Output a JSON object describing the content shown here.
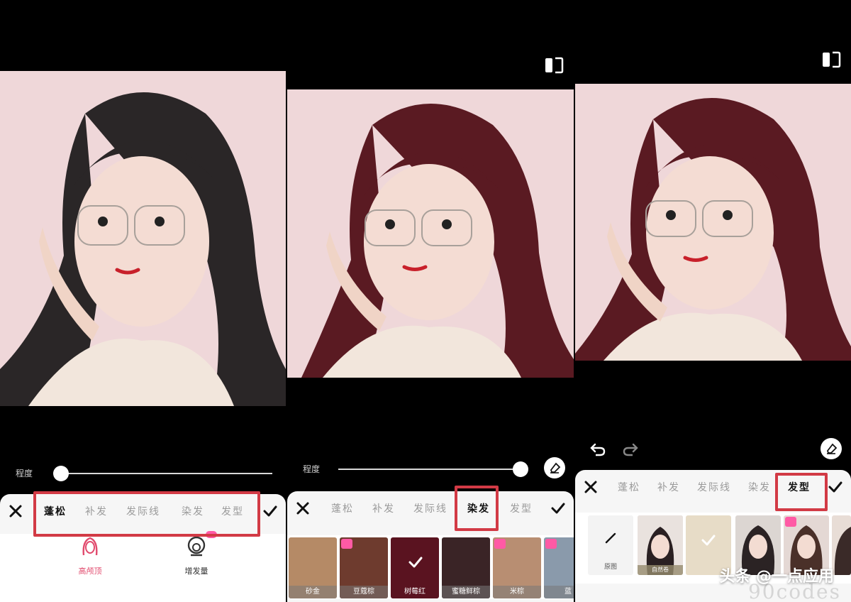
{
  "intensity_label": "程度",
  "tabs": [
    "蓬松",
    "补发",
    "发际线",
    "染发",
    "发型"
  ],
  "panel1": {
    "active_tab": "蓬松",
    "tools": [
      {
        "label": "高颅顶",
        "icon": "head-outline-icon",
        "color": "#e14a6d"
      },
      {
        "label": "增发量",
        "icon": "hair-volume-icon",
        "color": "#333333",
        "vip": true
      }
    ],
    "slider_value": 0.0
  },
  "panel2": {
    "active_tab": "染发",
    "slider_value": 1.0,
    "swatches": [
      {
        "label": "砂金",
        "color": "#b58a66",
        "vip": false
      },
      {
        "label": "豆蔻棕",
        "color": "#6e3b2e",
        "vip": true
      },
      {
        "label": "树莓红",
        "color": "#5a1320",
        "selected": true,
        "vip": false
      },
      {
        "label": "蜜糖鲜棕",
        "color": "#3a2426",
        "vip": false
      },
      {
        "label": "米棕",
        "color": "#b88e72",
        "vip": true
      },
      {
        "label": "蓝",
        "color": "#8a9aab",
        "vip": true
      }
    ]
  },
  "panel3": {
    "active_tab": "发型",
    "styles": [
      {
        "label": "原图",
        "type": "original"
      },
      {
        "label": "自然卷",
        "type": "photo"
      },
      {
        "label": "",
        "type": "selected"
      },
      {
        "label": "",
        "type": "photo"
      },
      {
        "label": "",
        "type": "photo",
        "vip": true
      },
      {
        "label": "",
        "type": "photo"
      }
    ]
  },
  "watermark": "头条 @一点应用",
  "watermark_faint": "90codes",
  "colors": {
    "highlight": "#d23a45",
    "hair_black": "#2a2627",
    "hair_red": "#5a1a22",
    "bg_pink": "#efd7d9"
  }
}
